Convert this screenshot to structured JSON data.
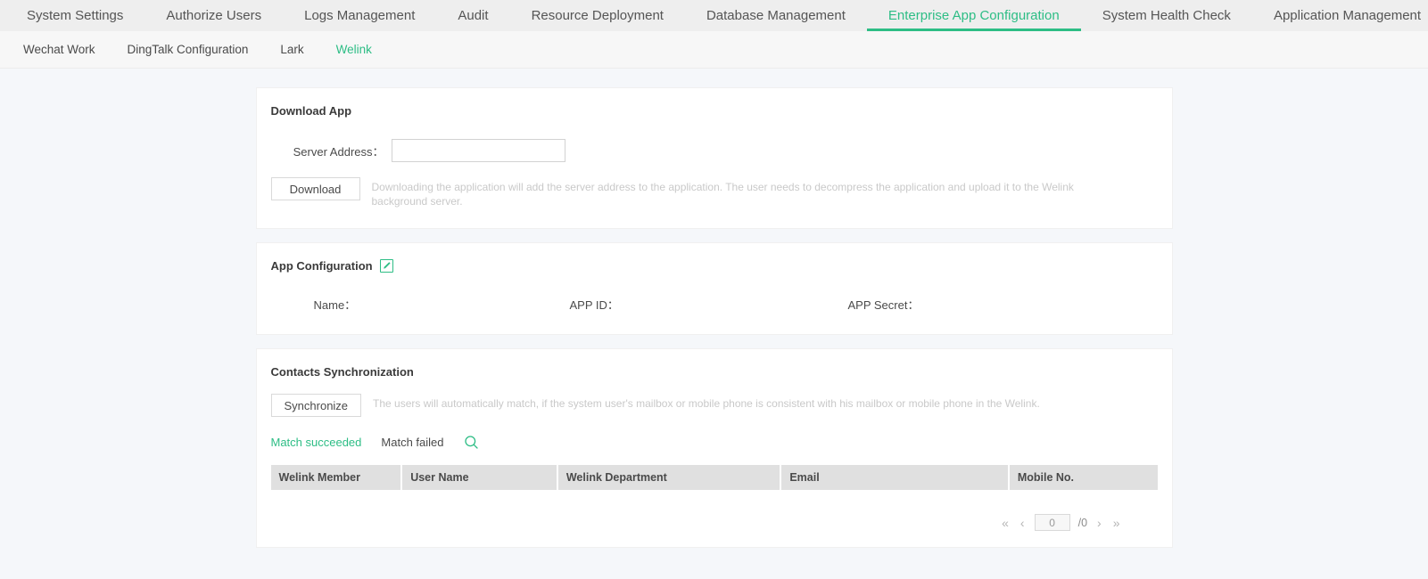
{
  "colors": {
    "accent": "#2dbd85",
    "page_bg": "#f5f7fa",
    "topnav_bg": "#eeeeee",
    "subnav_bg": "#f7f7f7",
    "table_header_bg": "#e0e0e0",
    "hint_text": "#c9c9c9"
  },
  "topnav": {
    "items": [
      {
        "label": "System Settings",
        "active": false
      },
      {
        "label": "Authorize Users",
        "active": false
      },
      {
        "label": "Logs Management",
        "active": false
      },
      {
        "label": "Audit",
        "active": false
      },
      {
        "label": "Resource Deployment",
        "active": false
      },
      {
        "label": "Database Management",
        "active": false
      },
      {
        "label": "Enterprise App Configuration",
        "active": true
      },
      {
        "label": "System Health Check",
        "active": false
      },
      {
        "label": "Application Management",
        "active": false
      }
    ]
  },
  "subnav": {
    "items": [
      {
        "label": "Wechat Work",
        "active": false
      },
      {
        "label": "DingTalk Configuration",
        "active": false
      },
      {
        "label": "Lark",
        "active": false
      },
      {
        "label": "Welink",
        "active": true
      }
    ]
  },
  "download_app": {
    "title": "Download App",
    "server_address_label": "Server Address：",
    "server_address_value": "",
    "server_address_placeholder": "",
    "download_button": "Download",
    "hint": "Downloading the application will add the server address to the application. The user needs to decompress the application and upload it to the Welink background server."
  },
  "app_configuration": {
    "title": "App Configuration",
    "edit_icon": "edit-pencil-icon",
    "fields": [
      {
        "label": "Name：",
        "value": ""
      },
      {
        "label": "APP ID：",
        "value": ""
      },
      {
        "label": "APP Secret：",
        "value": ""
      }
    ]
  },
  "contacts_sync": {
    "title": "Contacts Synchronization",
    "synchronize_button": "Synchronize",
    "hint": "The users will automatically match, if the system user's mailbox or mobile phone is consistent with his mailbox or mobile phone in the Welink.",
    "filters": [
      {
        "label": "Match succeeded",
        "active": true
      },
      {
        "label": "Match failed",
        "active": false
      }
    ],
    "search_icon": "search-icon",
    "table": {
      "columns": [
        "Welink Member",
        "User Name",
        "Welink Department",
        "Email",
        "Mobile No."
      ],
      "rows": []
    },
    "pagination": {
      "first": "«",
      "prev": "‹",
      "current_page": "0",
      "total": "/0",
      "next": "›",
      "last": "»"
    }
  }
}
